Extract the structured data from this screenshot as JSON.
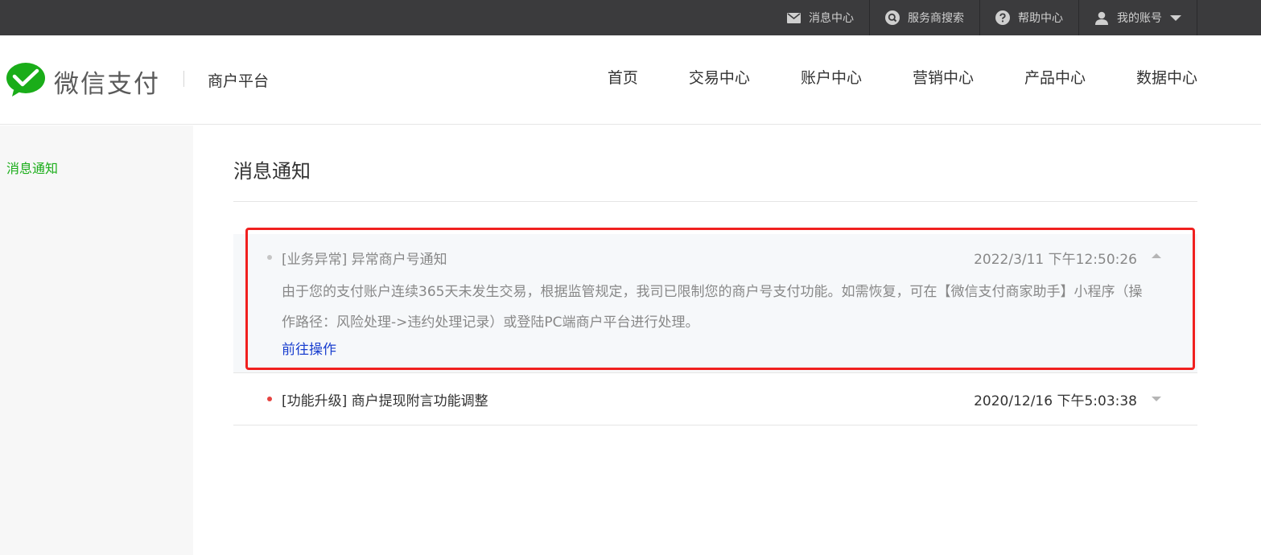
{
  "topnav": {
    "items": [
      {
        "label": "消息中心",
        "icon": "mail-icon"
      },
      {
        "label": "服务商搜索",
        "icon": "search-icon"
      },
      {
        "label": "帮助中心",
        "icon": "help-icon"
      },
      {
        "label": "我的账号",
        "icon": "user-icon"
      }
    ]
  },
  "header": {
    "logo_text": "微信支付",
    "platform": "商户平台",
    "nav": [
      "首页",
      "交易中心",
      "账户中心",
      "营销中心",
      "产品中心",
      "数据中心"
    ]
  },
  "sidebar": {
    "items": [
      "消息通知"
    ]
  },
  "main": {
    "title": "消息通知",
    "messages": [
      {
        "title": "[业务异常]  异常商户号通知",
        "time": "2022/3/11 下午12:50:26",
        "body": "由于您的支付账户连续365天未发生交易，根据监管规定，我司已限制您的商户号支付功能。如需恢复，可在【微信支付商家助手】小程序（操作路径：风险处理->违约处理记录）或登陆PC端商户平台进行处理。",
        "link": "前往操作",
        "expanded": true,
        "read": true
      },
      {
        "title": "[功能升级]  商户提现附言功能调整",
        "time": "2020/12/16 下午5:03:38",
        "expanded": false,
        "read": false
      }
    ]
  },
  "colors": {
    "brand_green": "#1aad19",
    "topbar": "#3b3b3d",
    "link_blue": "#1a3fcf",
    "highlight_red": "#f0201f",
    "unread_dot": "#e64340"
  }
}
